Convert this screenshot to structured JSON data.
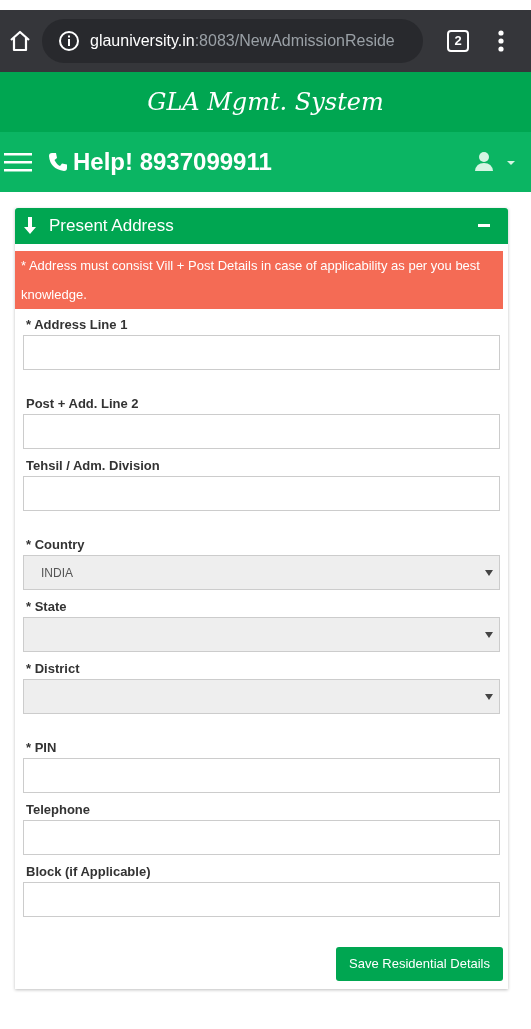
{
  "browser": {
    "url_host": "glauniversity.in",
    "url_path": ":8083/NewAdmissionReside",
    "tab_count": "2"
  },
  "header": {
    "title": "GLA Mgmt. System"
  },
  "navbar": {
    "help": "Help! 8937099911"
  },
  "panel": {
    "title": "Present Address",
    "expanded": true,
    "alert": "* Address must consist Vill + Post Details in case of applicability as per you best knowledge.",
    "fields": [
      {
        "kind": "text",
        "label": "* Address Line 1"
      },
      {
        "kind": "text",
        "label": "Post + Add. Line 2"
      },
      {
        "kind": "text",
        "label": "Tehsil / Adm. Division"
      },
      {
        "kind": "select",
        "label": "* Country",
        "value": "INDIA"
      },
      {
        "kind": "select",
        "label": "* State"
      },
      {
        "kind": "select",
        "label": "* District"
      },
      {
        "kind": "text",
        "label": "* PIN"
      },
      {
        "kind": "text",
        "label": "Telephone"
      },
      {
        "kind": "text",
        "label": "Block (if Applicable)"
      }
    ],
    "button": "Save Residential Details"
  }
}
